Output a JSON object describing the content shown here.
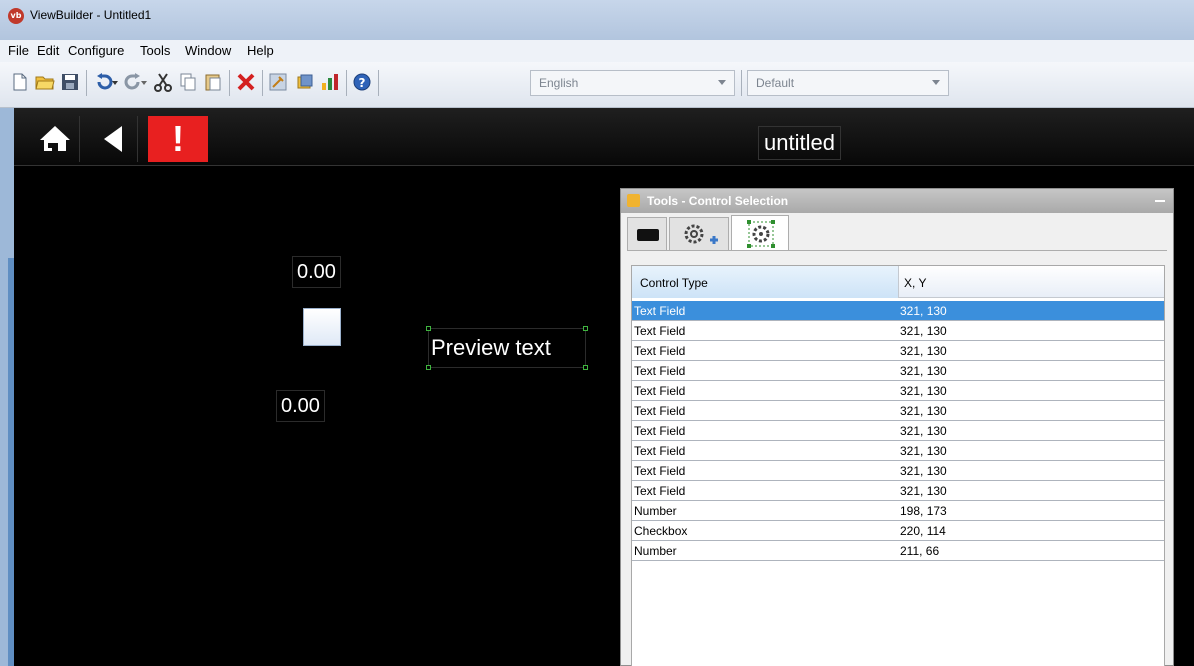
{
  "window": {
    "title": "ViewBuilder - Untitled1",
    "app_icon_text": "vb"
  },
  "menu": [
    "File",
    "Edit",
    "Configure",
    "Tools",
    "Window",
    "Help"
  ],
  "toolbar": {
    "language": "English",
    "profile": "Default",
    "icons": [
      "new-file-icon",
      "open-folder-icon",
      "save-icon",
      "undo-icon",
      "redo-icon",
      "cut-icon",
      "copy-icon",
      "paste-icon",
      "delete-icon",
      "tools-icon",
      "screens-icon",
      "chart-icon",
      "help-icon"
    ]
  },
  "screen": {
    "title": "untitled",
    "alert_symbol": "!",
    "number_top": "0.00",
    "number_bottom": "0.00",
    "preview_text": "Preview text"
  },
  "panel": {
    "title": "Tools - Control Selection",
    "tabs": [
      "controls-tab",
      "add-control-tab",
      "control-selection-tab"
    ],
    "columns": [
      "Control Type",
      "X, Y"
    ],
    "rows": [
      [
        "Text Field",
        "321, 130"
      ],
      [
        "Text Field",
        "321, 130"
      ],
      [
        "Text Field",
        "321, 130"
      ],
      [
        "Text Field",
        "321, 130"
      ],
      [
        "Text Field",
        "321, 130"
      ],
      [
        "Text Field",
        "321, 130"
      ],
      [
        "Text Field",
        "321, 130"
      ],
      [
        "Text Field",
        "321, 130"
      ],
      [
        "Text Field",
        "321, 130"
      ],
      [
        "Text Field",
        "321, 130"
      ],
      [
        "Number",
        "198, 173"
      ],
      [
        "Checkbox",
        "220, 114"
      ],
      [
        "Number",
        "211, 66"
      ]
    ],
    "selected_row": 0
  },
  "colors": {
    "alert": "#e82020",
    "selection": "#3b8fdc",
    "canvas": "#000000"
  }
}
